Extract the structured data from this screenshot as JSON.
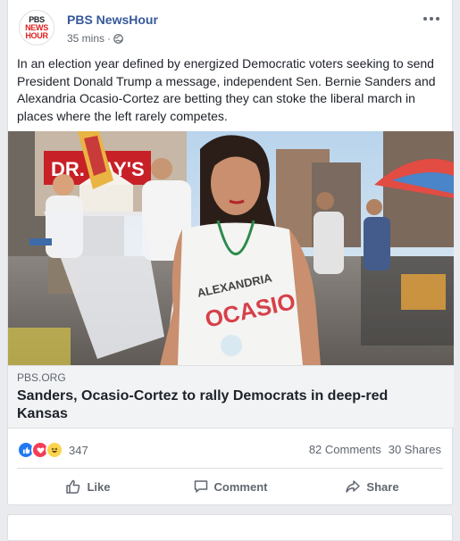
{
  "post": {
    "page_name": "PBS NewsHour",
    "timestamp": "35 mins",
    "separator": "·",
    "avatar_lines": [
      "PBS",
      "NEWS",
      "HOUR"
    ],
    "text": "In an election year defined by energized Democratic voters seeking to send President Donald Trump a message, independent Sen. Bernie Sanders and Alexandria Ocasio-Cortez are betting they can stoke the liberal march in places where the left rarely competes.",
    "photo_sign_text": "DR. JAY'S",
    "photo_shirt_text": [
      "ALEXANDRIA",
      "OCASIO"
    ]
  },
  "link": {
    "domain": "PBS.ORG",
    "headline": "Sanders, Ocasio-Cortez to rally Democrats in deep-red Kansas"
  },
  "stats": {
    "reaction_count": "347",
    "comments": "82 Comments",
    "shares": "30 Shares",
    "reaction_icons": [
      "like-icon",
      "love-icon",
      "haha-icon"
    ]
  },
  "actions": {
    "like": "Like",
    "comment": "Comment",
    "share": "Share"
  },
  "colors": {
    "link_blue": "#365899",
    "like_blue": "#2078f4",
    "love_red": "#f33e58",
    "haha_yellow": "#fcd34d"
  }
}
